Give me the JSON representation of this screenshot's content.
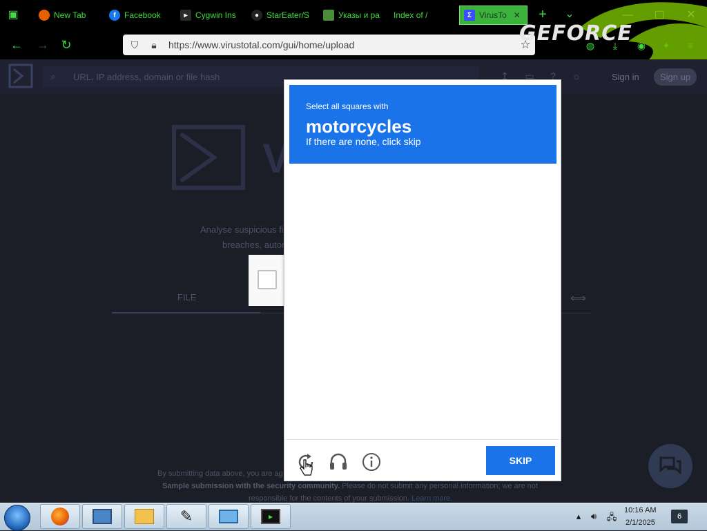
{
  "browser": {
    "tabs": [
      {
        "label": "New Tab",
        "fav_color": "#e66000"
      },
      {
        "label": "Facebook",
        "fav_color": "#1877f2"
      },
      {
        "label": "Cygwin Ins",
        "fav_color": "#2b2b2b"
      },
      {
        "label": "StarEater/S",
        "fav_color": "#222222"
      },
      {
        "label": "Указы и ра",
        "fav_color": "#4a8c3a"
      },
      {
        "label": "Index of /",
        "fav_color": ""
      },
      {
        "label": "VirusTo",
        "fav_color": "#394eff",
        "active": true
      }
    ],
    "url": "https://www.virustotal.com/gui/home/upload",
    "overlay_brand": "GEFORCE"
  },
  "vt": {
    "search_placeholder": "URL, IP address, domain or file hash",
    "sign_in": "Sign in",
    "sign_up": "Sign up",
    "logo_text": "V",
    "desc_line1": "Analyse suspicious fi",
    "desc_line2": "breaches, autor",
    "tab_file": "FILE",
    "footer_line1": "By submitting data above, you are ag",
    "footer_line2_bold": "Sample submission with the security community.",
    "footer_line2": " Please do not submit any personal information; we are not",
    "footer_line3": "responsible for the contents of your submission.",
    "footer_learn_more": " Learn more."
  },
  "captcha": {
    "prompt_pre": "Select all squares with",
    "prompt_object": "motorcycles",
    "prompt_post": "If there are none, click skip",
    "skip_label": "SKIP",
    "colors": {
      "accent": "#1a73e8"
    }
  },
  "taskbar": {
    "time": "10:16 AM",
    "date": "2/1/2025",
    "notification_count": "6"
  }
}
